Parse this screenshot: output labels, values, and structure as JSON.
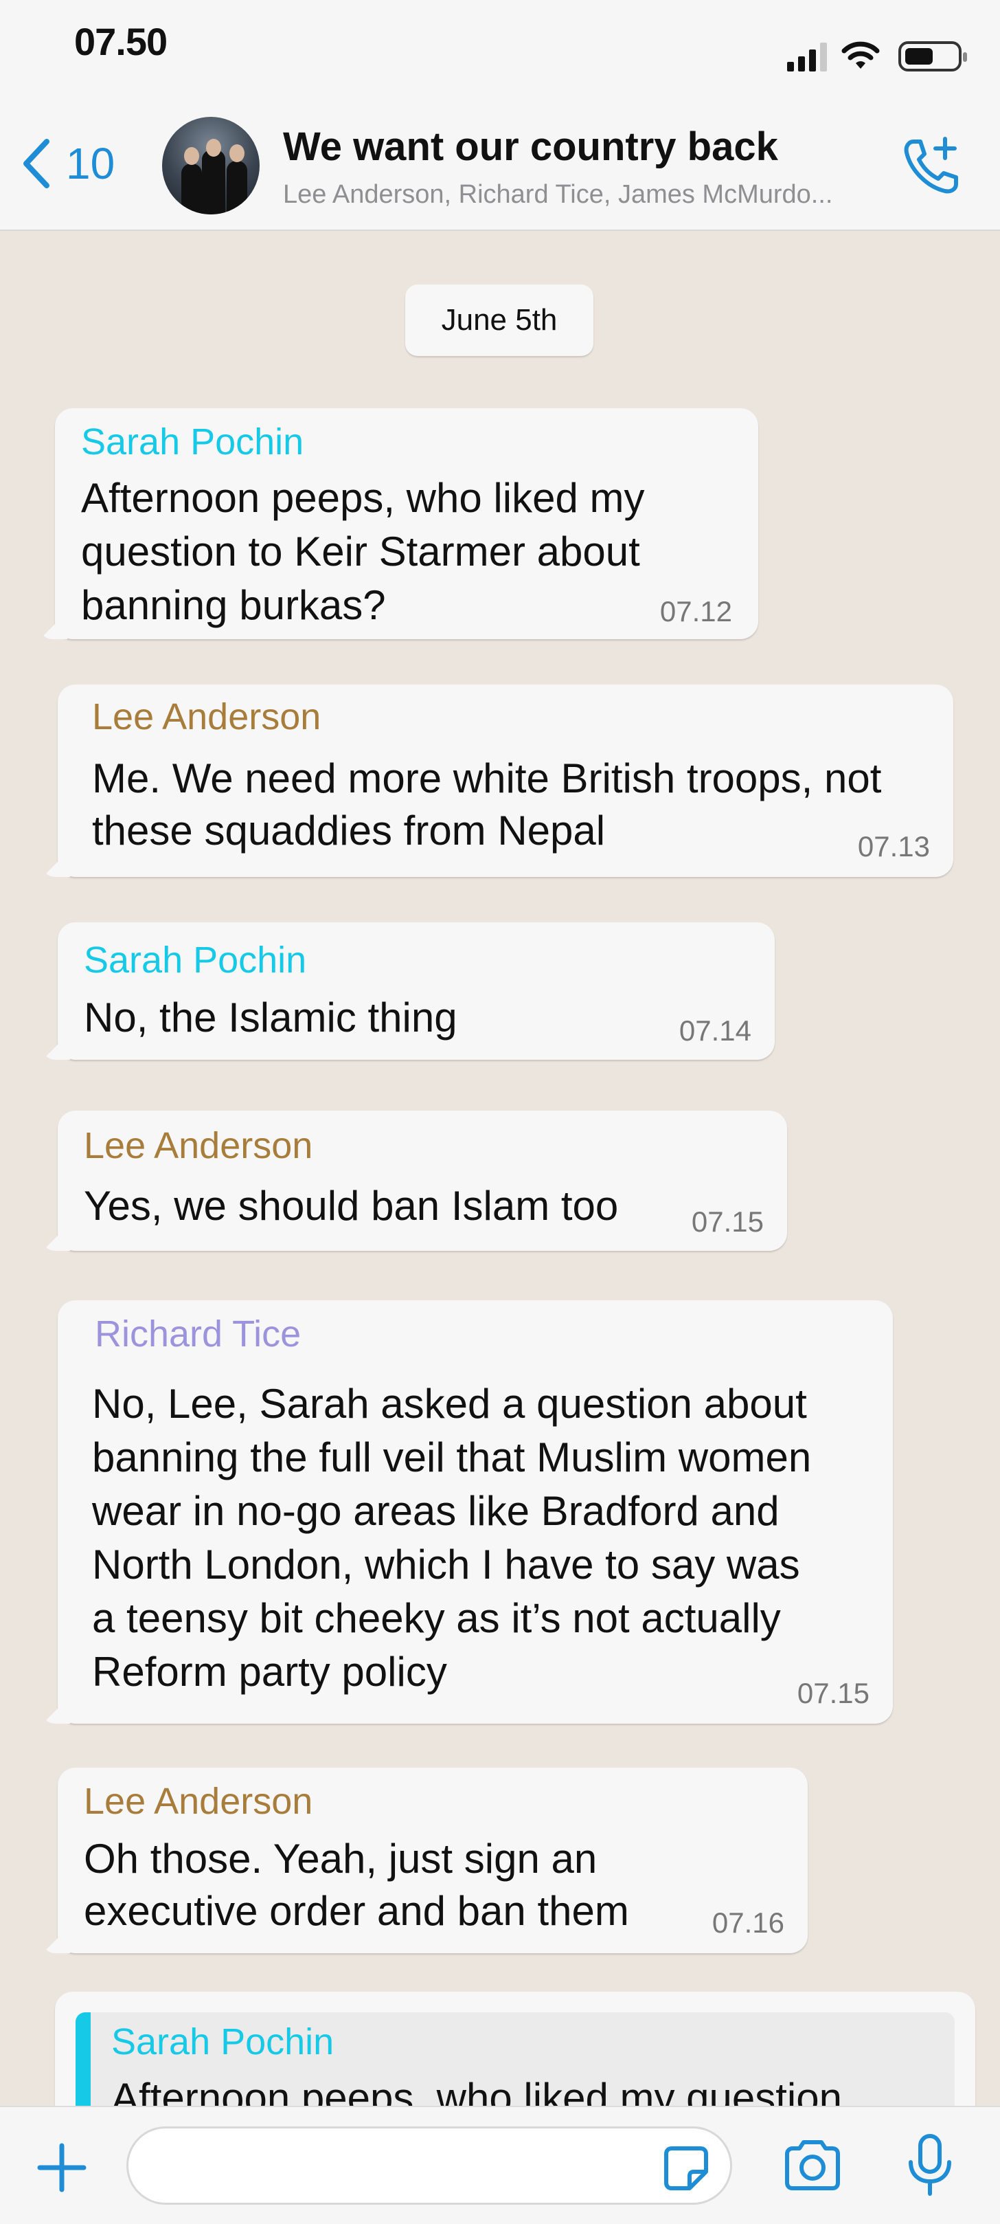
{
  "status_bar": {
    "time": "07.50"
  },
  "header": {
    "back_count": "10",
    "title": "We want our country back",
    "members": "Lee Anderson, Richard Tice, James McMurdo..."
  },
  "chat": {
    "date": "June 5th",
    "messages": [
      {
        "sender": "Sarah Pochin",
        "sender_color": "#16c9e6",
        "lines": [
          "Afternoon peeps, who liked my",
          "question to Keir Starmer about",
          "banning burkas?"
        ],
        "time": "07.12"
      },
      {
        "sender": "Lee Anderson",
        "sender_color": "#a87c3a",
        "lines": [
          "Me. We need more white British troops, not",
          "these squaddies from Nepal"
        ],
        "time": "07.13"
      },
      {
        "sender": "Sarah Pochin",
        "sender_color": "#16c9e6",
        "lines": [
          "No, the Islamic thing"
        ],
        "time": "07.14"
      },
      {
        "sender": "Lee Anderson",
        "sender_color": "#a87c3a",
        "lines": [
          "Yes, we should ban Islam too"
        ],
        "time": "07.15"
      },
      {
        "sender": "Richard Tice",
        "sender_color": "#9b94dc",
        "lines": [
          "No, Lee, Sarah asked a question about",
          "banning the full veil that Muslim women",
          "wear in no-go areas like Bradford and",
          "North London, which I have to say was",
          "a teensy bit cheeky as it’s not actually",
          "Reform party policy"
        ],
        "time": "07.15"
      },
      {
        "sender": "Lee Anderson",
        "sender_color": "#a87c3a",
        "lines": [
          "Oh those. Yeah, just sign an",
          "executive order and ban them"
        ],
        "time": "07.16"
      }
    ],
    "reply_preview": {
      "sender": "Sarah Pochin",
      "text": "Afternoon peeps, who liked my question"
    }
  },
  "input_bar": {
    "message_placeholder": "",
    "icons": [
      "plus-icon",
      "sticker-icon",
      "camera-icon",
      "microphone-icon"
    ]
  },
  "colors": {
    "accent": "#1f8dd6",
    "chat_background": "#ece5dd",
    "bubble": "#f7f7f7"
  }
}
